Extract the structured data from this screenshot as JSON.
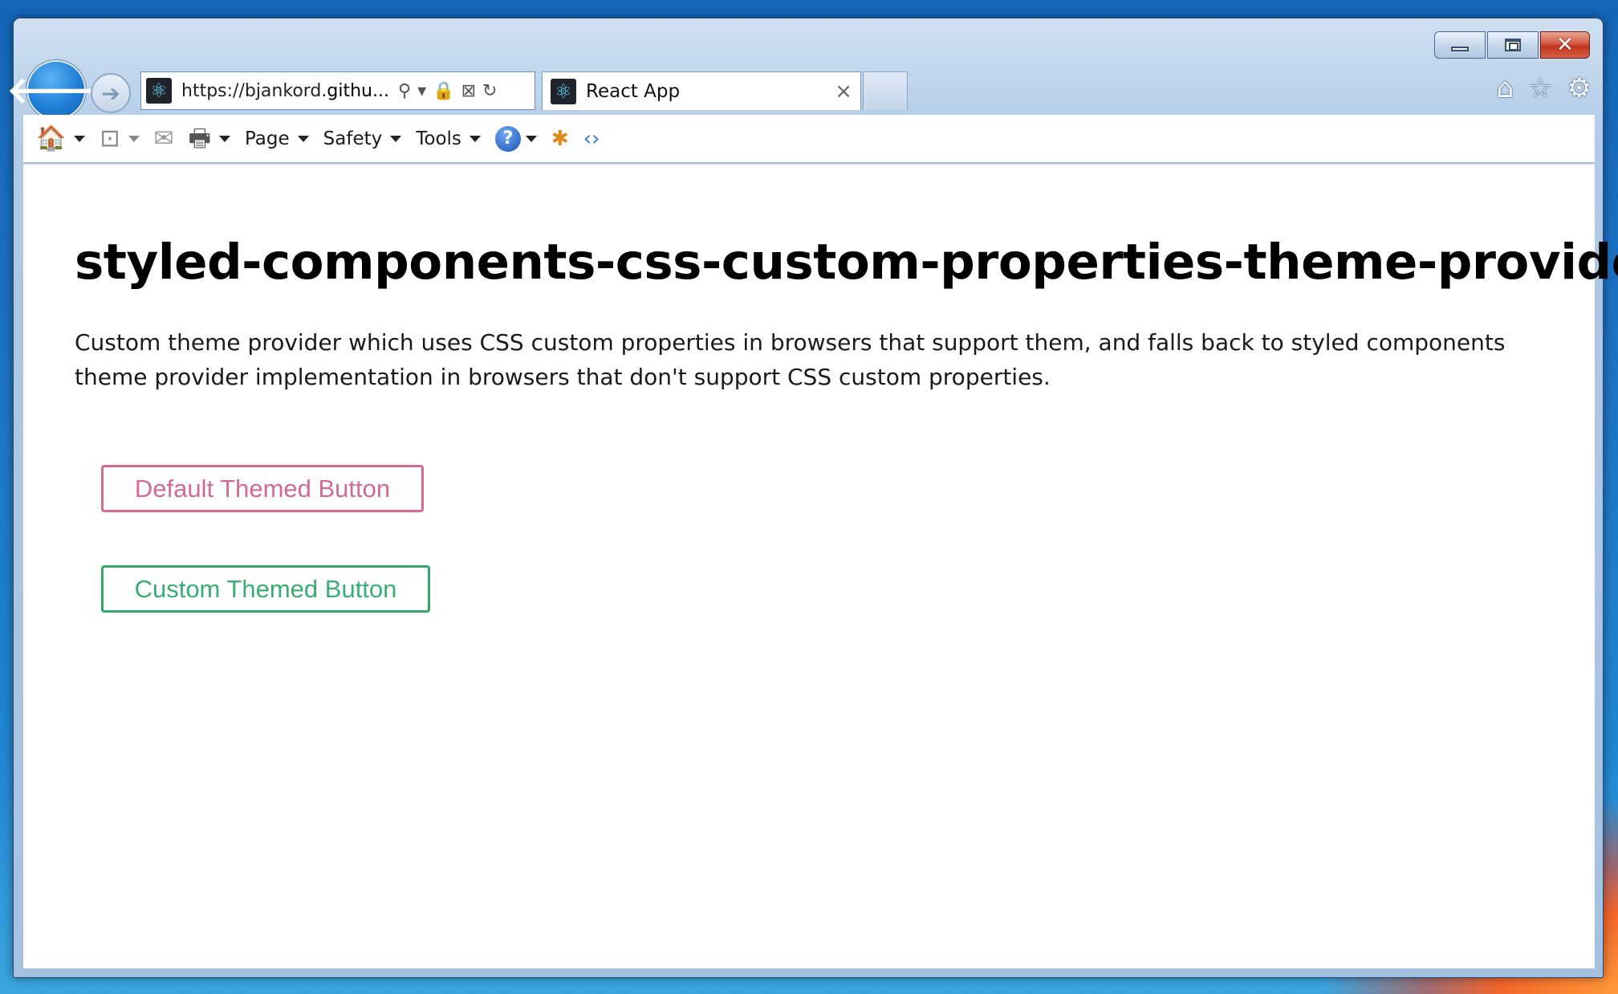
{
  "browser": {
    "address_url_prefix": "https://bjankord.",
    "address_url_host": "githu...",
    "tab_title": "React App",
    "tab_close_glyph": "×",
    "command_bar": {
      "page_label": "Page",
      "safety_label": "Safety",
      "tools_label": "Tools"
    }
  },
  "page": {
    "title": "styled-components-css-custom-properties-theme-provider",
    "description": "Custom theme provider which uses CSS custom properties in browsers that support them, and falls back to styled components theme provider implementation in browsers that don't support CSS custom properties.",
    "default_button_label": "Default Themed Button",
    "custom_button_label": "Custom Themed Button"
  },
  "colors": {
    "default_theme": "#d86a92",
    "custom_theme": "#34a86b"
  },
  "icons": [
    "back-arrow-icon",
    "forward-arrow-icon",
    "react-favicon-icon",
    "search-icon",
    "lock-icon",
    "compat-view-icon",
    "refresh-icon",
    "home-icon",
    "favorites-star-icon",
    "settings-gear-icon",
    "rss-feed-icon",
    "mail-icon",
    "print-icon",
    "help-icon",
    "bug-icon",
    "developer-tools-icon"
  ]
}
